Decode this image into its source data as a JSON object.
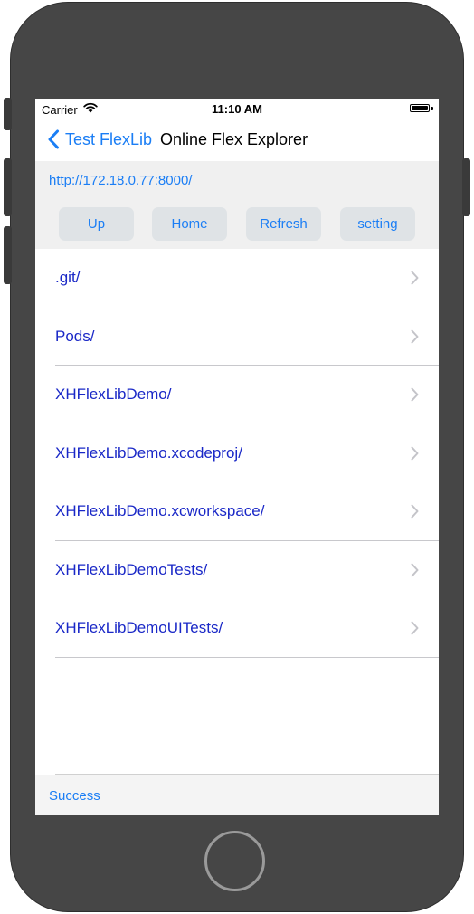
{
  "status_bar": {
    "carrier": "Carrier",
    "time": "11:10 AM"
  },
  "nav": {
    "back_label": "Test FlexLib",
    "title": "Online Flex Explorer"
  },
  "server": {
    "url": "http://172.18.0.77:8000/"
  },
  "toolbar": {
    "buttons": [
      "Up",
      "Home",
      "Refresh",
      "setting"
    ]
  },
  "files": [
    ".git/",
    "Pods/",
    "XHFlexLibDemo/",
    "XHFlexLibDemo.xcodeproj/",
    "XHFlexLibDemo.xcworkspace/",
    "XHFlexLibDemoTests/",
    "XHFlexLibDemoUITests/"
  ],
  "status": {
    "message": "Success"
  },
  "colors": {
    "accent": "#1b7ef5",
    "file_link": "#1a28c7",
    "device_frame": "#464646"
  },
  "icons": {
    "back": "chevron-left-icon",
    "row": "chevron-right-icon",
    "wifi": "wifi-icon",
    "battery": "battery-icon"
  }
}
